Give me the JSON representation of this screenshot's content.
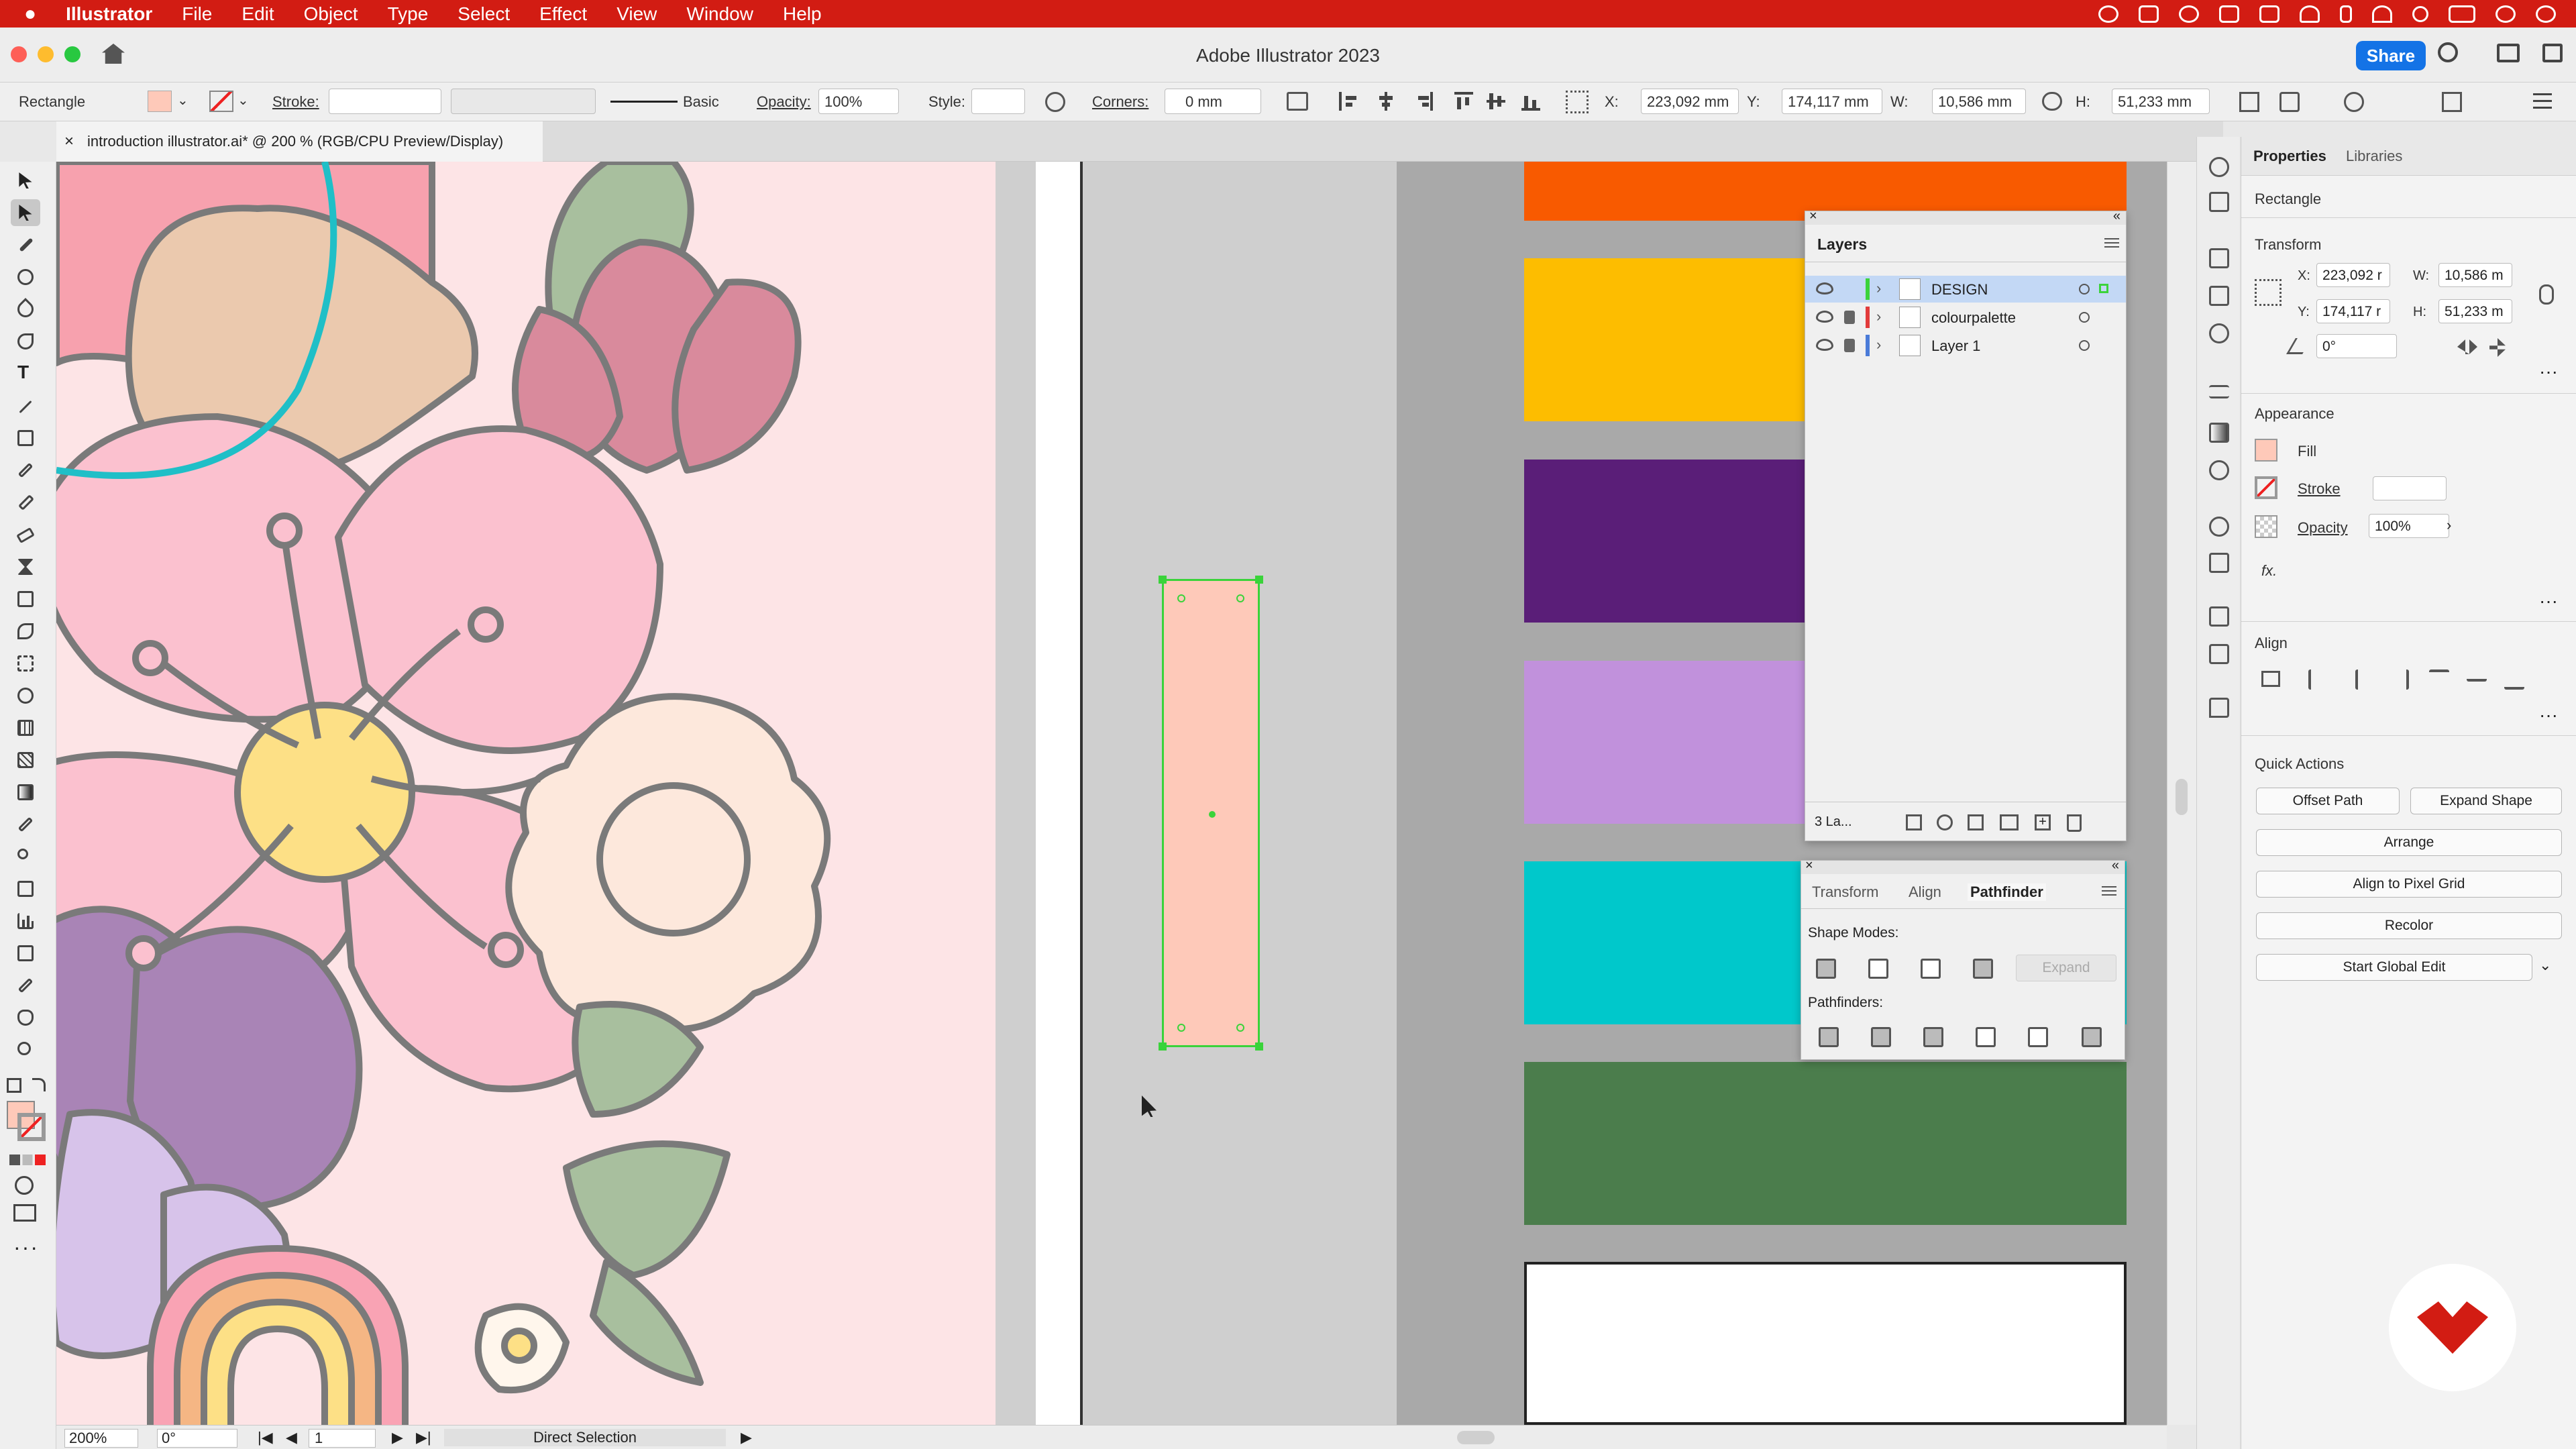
{
  "menubar": {
    "app": "Illustrator",
    "items": [
      "File",
      "Edit",
      "Object",
      "Type",
      "Select",
      "Effect",
      "View",
      "Window",
      "Help"
    ]
  },
  "window": {
    "title": "Adobe Illustrator 2023",
    "share_label": "Share"
  },
  "control_bar": {
    "object_type": "Rectangle",
    "stroke_label": "Stroke:",
    "stroke_profile": "Basic",
    "opacity_label": "Opacity:",
    "opacity_value": "100%",
    "style_label": "Style:",
    "corners_label": "Corners:",
    "corners_value": "0 mm",
    "x_label": "X:",
    "x_value": "223,092 mm",
    "y_label": "Y:",
    "y_value": "174,117 mm",
    "w_label": "W:",
    "w_value": "10,586 mm",
    "h_label": "H:",
    "h_value": "51,233 mm"
  },
  "document_tab": {
    "title": "introduction illustrator.ai* @ 200 % (RGB/CPU Preview/Display)",
    "close": "×"
  },
  "status_bar": {
    "zoom": "200%",
    "rotation": "0°",
    "artboard": "1",
    "tool": "Direct Selection"
  },
  "colours": {
    "menubar": "#d21c13",
    "swatches": [
      "#f85a00",
      "#fdbd00",
      "#5a1e78",
      "#c191dc",
      "#00c8cb",
      "#4b7d4c",
      "#ffffff"
    ],
    "selected_rect_fill": "#fec9b9",
    "selection_green": "#3ad33a"
  },
  "layers_panel": {
    "title": "Layers",
    "layers": [
      {
        "name": "DESIGN",
        "color": "#3bd33b",
        "selected": true
      },
      {
        "name": "colourpalette",
        "color": "#e23b3b",
        "selected": false
      },
      {
        "name": "Layer 1",
        "color": "#4a7bd8",
        "selected": false
      }
    ],
    "footer_count": "3 La..."
  },
  "pathfinder_panel": {
    "tabs": [
      "Transform",
      "Align",
      "Pathfinder"
    ],
    "active_tab": "Pathfinder",
    "shape_modes_label": "Shape Modes:",
    "expand_label": "Expand",
    "pathfinders_label": "Pathfinders:"
  },
  "properties_panel": {
    "tabs": [
      "Properties",
      "Libraries"
    ],
    "object_type": "Rectangle",
    "transform_label": "Transform",
    "x_label": "X:",
    "x_value": "223,092 r",
    "y_label": "Y:",
    "y_value": "174,117 r",
    "w_label": "W:",
    "w_value": "10,586 m",
    "h_label": "H:",
    "h_value": "51,233 m",
    "angle_value": "0°",
    "appearance_label": "Appearance",
    "fill_label": "Fill",
    "stroke_label": "Stroke",
    "opacity_label": "Opacity",
    "opacity_value": "100%",
    "fx_label": "fx.",
    "align_label": "Align",
    "quick_actions_label": "Quick Actions",
    "buttons": {
      "offset_path": "Offset Path",
      "expand_shape": "Expand Shape",
      "arrange": "Arrange",
      "align_pixel": "Align to Pixel Grid",
      "recolor": "Recolor",
      "global_edit": "Start Global Edit"
    }
  }
}
